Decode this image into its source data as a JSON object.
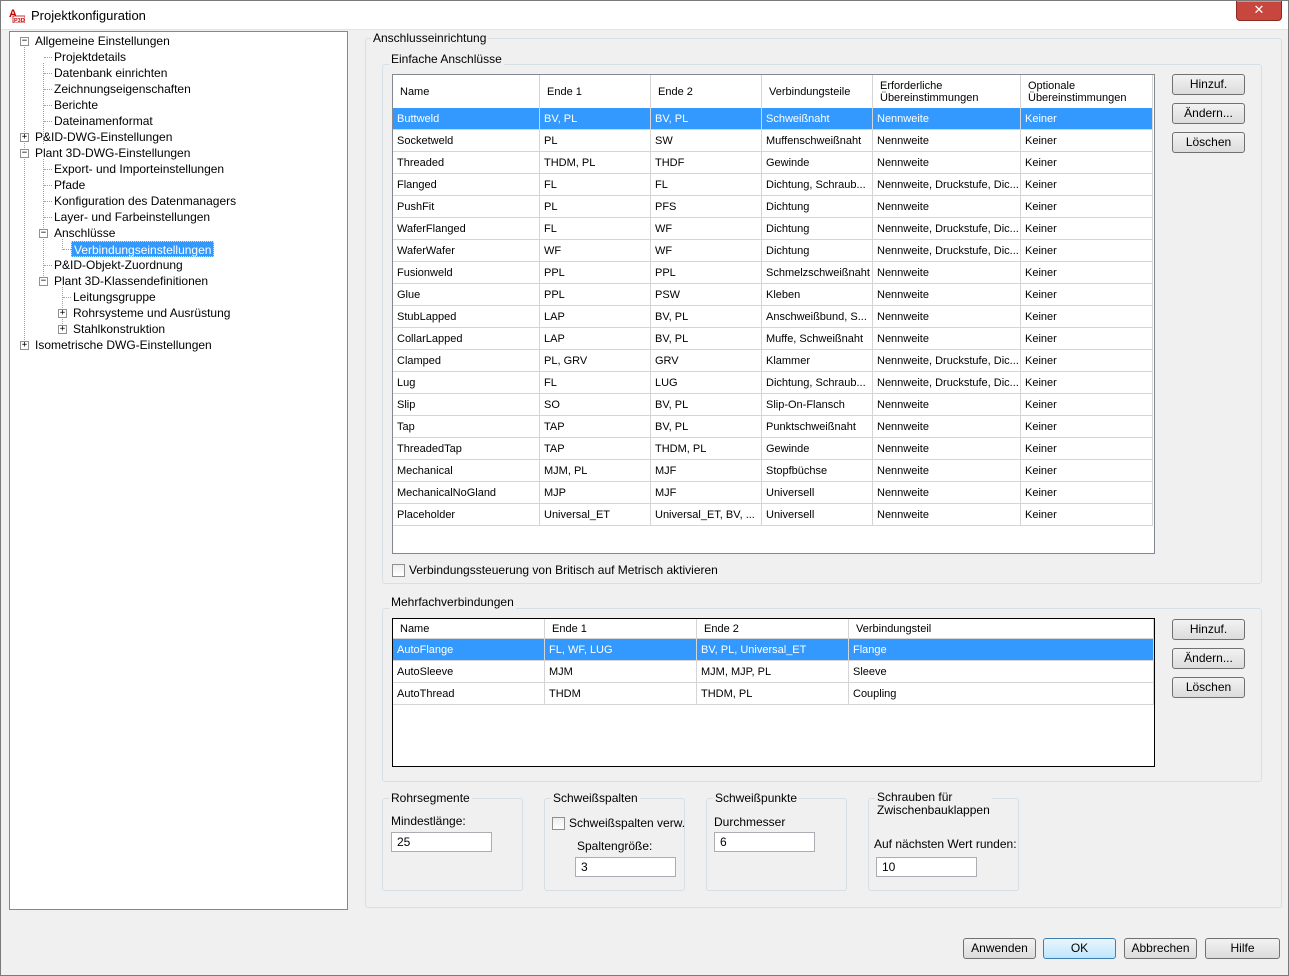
{
  "window": {
    "title": "Projektkonfiguration",
    "close_label": "✕"
  },
  "tree": [
    {
      "label": "Allgemeine Einstellungen"
    },
    {
      "label": "Projektdetails"
    },
    {
      "label": "Datenbank einrichten"
    },
    {
      "label": "Zeichnungseigenschaften"
    },
    {
      "label": "Berichte"
    },
    {
      "label": "Dateinamenformat"
    },
    {
      "label": "P&ID-DWG-Einstellungen"
    },
    {
      "label": "Plant 3D-DWG-Einstellungen"
    },
    {
      "label": "Export- und Importeinstellungen"
    },
    {
      "label": "Pfade"
    },
    {
      "label": "Konfiguration des Datenmanagers"
    },
    {
      "label": "Layer- und Farbeinstellungen"
    },
    {
      "label": "Anschlüsse"
    },
    {
      "label": "Verbindungseinstellungen"
    },
    {
      "label": "P&ID-Objekt-Zuordnung"
    },
    {
      "label": "Plant 3D-Klassendefinitionen"
    },
    {
      "label": "Leitungsgruppe"
    },
    {
      "label": "Rohrsysteme und Ausrüstung"
    },
    {
      "label": "Stahlkonstruktion"
    },
    {
      "label": "Isometrische DWG-Einstellungen"
    }
  ],
  "main": {
    "section_title": "Anschlusseinrichtung",
    "simple": {
      "group_label": "Einfache Anschlüsse",
      "headers": [
        "Name",
        "Ende 1",
        "Ende 2",
        "Verbindungsteile",
        "Erforderliche Übereinstimmungen",
        "Optionale Übereinstimmungen"
      ],
      "rows": [
        [
          "Buttweld",
          "BV, PL",
          "BV, PL",
          "Schweißnaht",
          "Nennweite",
          "Keiner"
        ],
        [
          "Socketweld",
          "PL",
          "SW",
          "Muffenschweißnaht",
          "Nennweite",
          "Keiner"
        ],
        [
          "Threaded",
          "THDM, PL",
          "THDF",
          "Gewinde",
          "Nennweite",
          "Keiner"
        ],
        [
          "Flanged",
          "FL",
          "FL",
          "Dichtung, Schraub...",
          "Nennweite, Druckstufe, Dic...",
          "Keiner"
        ],
        [
          "PushFit",
          "PL",
          "PFS",
          "Dichtung",
          "Nennweite",
          "Keiner"
        ],
        [
          "WaferFlanged",
          "FL",
          "WF",
          "Dichtung",
          "Nennweite, Druckstufe, Dic...",
          "Keiner"
        ],
        [
          "WaferWafer",
          "WF",
          "WF",
          "Dichtung",
          "Nennweite, Druckstufe, Dic...",
          "Keiner"
        ],
        [
          "Fusionweld",
          "PPL",
          "PPL",
          "Schmelzschweißnaht",
          "Nennweite",
          "Keiner"
        ],
        [
          "Glue",
          "PPL",
          "PSW",
          "Kleben",
          "Nennweite",
          "Keiner"
        ],
        [
          "StubLapped",
          "LAP",
          "BV, PL",
          "Anschweißbund, S...",
          "Nennweite",
          "Keiner"
        ],
        [
          "CollarLapped",
          "LAP",
          "BV, PL",
          "Muffe, Schweißnaht",
          "Nennweite",
          "Keiner"
        ],
        [
          "Clamped",
          "PL, GRV",
          "GRV",
          "Klammer",
          "Nennweite, Druckstufe, Dic...",
          "Keiner"
        ],
        [
          "Lug",
          "FL",
          "LUG",
          "Dichtung, Schraub...",
          "Nennweite, Druckstufe, Dic...",
          "Keiner"
        ],
        [
          "Slip",
          "SO",
          "BV, PL",
          "Slip-On-Flansch",
          "Nennweite",
          "Keiner"
        ],
        [
          "Tap",
          "TAP",
          "BV, PL",
          "Punktschweißnaht",
          "Nennweite",
          "Keiner"
        ],
        [
          "ThreadedTap",
          "TAP",
          "THDM, PL",
          "Gewinde",
          "Nennweite",
          "Keiner"
        ],
        [
          "Mechanical",
          "MJM, PL",
          "MJF",
          "Stopfbüchse",
          "Nennweite",
          "Keiner"
        ],
        [
          "MechanicalNoGland",
          "MJP",
          "MJF",
          "Universell",
          "Nennweite",
          "Keiner"
        ],
        [
          "Placeholder",
          "Universal_ET",
          "Universal_ET, BV, ...",
          "Universell",
          "Nennweite",
          "Keiner"
        ]
      ],
      "add_label": "Hinzuf.",
      "edit_label": "Ändern...",
      "delete_label": "Löschen",
      "checkbox_label": "Verbindungssteuerung von Britisch auf Metrisch aktivieren"
    },
    "multi": {
      "group_label": "Mehrfachverbindungen",
      "headers": [
        "Name",
        "Ende 1",
        "Ende 2",
        "Verbindungsteil"
      ],
      "rows": [
        [
          "AutoFlange",
          "FL, WF, LUG",
          "BV, PL, Universal_ET",
          "Flange"
        ],
        [
          "AutoSleeve",
          "MJM",
          "MJM, MJP, PL",
          "Sleeve"
        ],
        [
          "AutoThread",
          "THDM",
          "THDM, PL",
          "Coupling"
        ]
      ],
      "add_label": "Hinzuf.",
      "edit_label": "Ändern...",
      "delete_label": "Löschen"
    },
    "pipe_segments": {
      "group_label": "Rohrsegmente",
      "field_label": "Mindestlänge:",
      "value": "25"
    },
    "weld_gaps": {
      "group_label": "Schweißspalten",
      "checkbox_label": "Schweißspalten verw.",
      "field_label": "Spaltengröße:",
      "value": "3"
    },
    "weld_points": {
      "group_label": "Schweißpunkte",
      "field_label": "Durchmesser",
      "value": "6"
    },
    "bolts": {
      "group_label_line1": "Schrauben für",
      "group_label_line2": "Zwischenbauklappen",
      "field_label": "Auf nächsten Wert runden:",
      "value": "10"
    }
  },
  "footer": {
    "apply_label": "Anwenden",
    "ok_label": "OK",
    "cancel_label": "Abbrechen",
    "help_label": "Hilfe"
  }
}
